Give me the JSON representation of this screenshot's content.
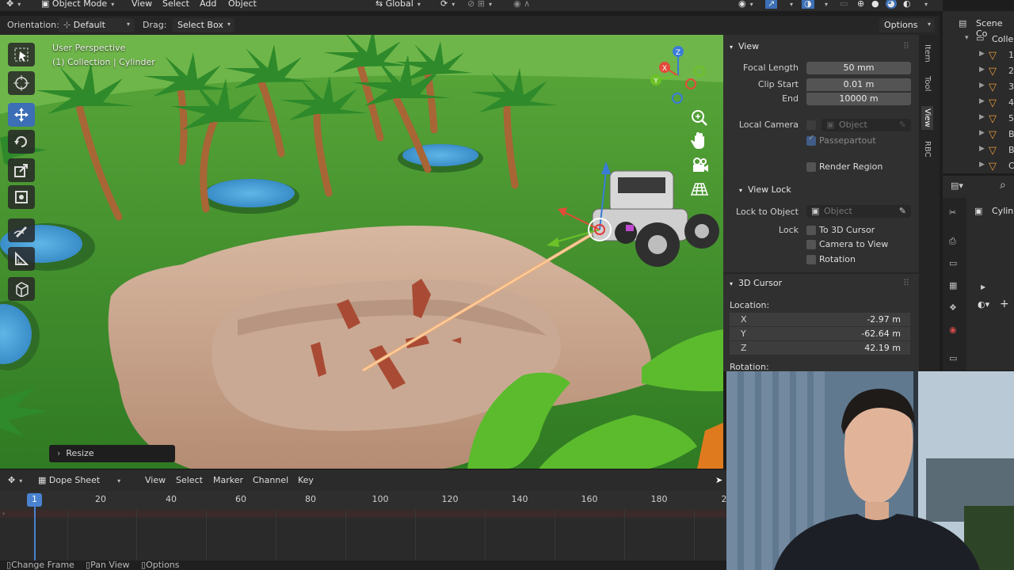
{
  "top_header": {
    "mode": "Object Mode",
    "menus": [
      "View",
      "Select",
      "Add",
      "Object"
    ],
    "transform_space": "Global"
  },
  "tool_header": {
    "orientation_label": "Orientation:",
    "orientation_value": "Default",
    "drag_label": "Drag:",
    "drag_value": "Select Box",
    "options_label": "Options"
  },
  "viewport": {
    "perspective_label": "User Perspective",
    "object_label": "(1) Collection | Cylinder",
    "last_operator": "Resize",
    "gizmo_axes": [
      "Z",
      "X",
      "Y"
    ]
  },
  "n_panel": {
    "view": {
      "title": "View",
      "focal_length_label": "Focal Length",
      "focal_length": "50 mm",
      "clip_start_label": "Clip Start",
      "clip_start": "0.01 m",
      "end_label": "End",
      "end": "10000 m",
      "local_camera_label": "Local Camera",
      "local_camera_placeholder": "Object",
      "passepartout_label": "Passepartout",
      "render_region_label": "Render Region"
    },
    "view_lock": {
      "title": "View Lock",
      "lock_to_object_label": "Lock to Object",
      "lock_to_object_placeholder": "Object",
      "lock_label": "Lock",
      "to_3d_cursor": "To 3D Cursor",
      "camera_to_view": "Camera to View",
      "rotation": "Rotation"
    },
    "cursor": {
      "title": "3D Cursor",
      "location_label": "Location:",
      "x_label": "X",
      "x": "-2.97 m",
      "y_label": "Y",
      "y": "-62.64 m",
      "z_label": "Z",
      "z": "42.19 m",
      "rotation_label": "Rotation:"
    },
    "tabs": [
      "Item",
      "Tool",
      "View",
      "RBC"
    ]
  },
  "outliner": {
    "scene_label": "Scene Co",
    "collection_label": "Colle",
    "rows": [
      "1",
      "2",
      "3",
      "4",
      "5",
      "B",
      "B",
      "C"
    ]
  },
  "properties": {
    "object_label": "Cylin"
  },
  "dope_sheet": {
    "editor": "Dope Sheet",
    "menus": [
      "View",
      "Select",
      "Marker",
      "Channel",
      "Key"
    ],
    "current_frame": "1",
    "frame_ticks": [
      "20",
      "40",
      "60",
      "80",
      "100",
      "120",
      "140",
      "160",
      "180",
      "2"
    ]
  },
  "status_bar": {
    "items": [
      "Change Frame",
      "Pan View",
      "Options"
    ]
  },
  "colors": {
    "accent": "#4a82d0",
    "active_tool": "#3c6fb6",
    "grass": "#3f8a2c",
    "outliner_cone": "#e79a3a"
  }
}
